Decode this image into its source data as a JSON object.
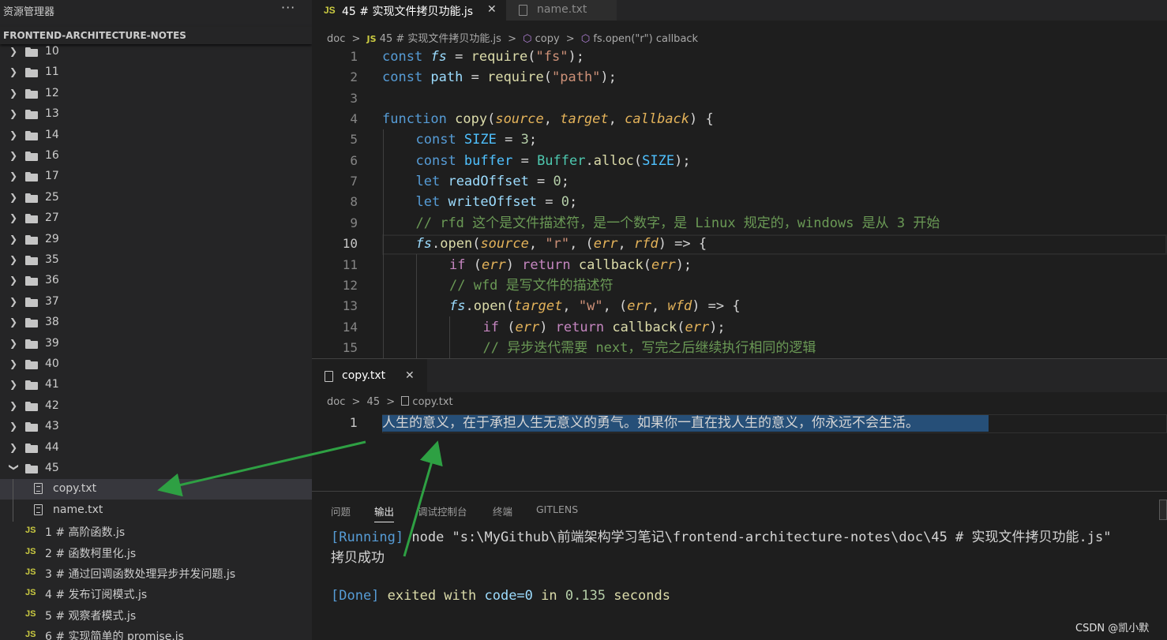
{
  "sidebar": {
    "title": "资源管理器",
    "more": "···",
    "root": "FRONTEND-ARCHITECTURE-NOTES",
    "folders": [
      "10",
      "11",
      "12",
      "13",
      "14",
      "16",
      "17",
      "25",
      "27",
      "29",
      "35",
      "36",
      "37",
      "38",
      "39",
      "40",
      "41",
      "42",
      "43",
      "44"
    ],
    "open_folder": "45",
    "open_folder_files": [
      "copy.txt",
      "name.txt"
    ],
    "js_badge": "JS",
    "js_files": [
      "1 # 高阶函数.js",
      "2 # 函数柯里化.js",
      "3 # 通过回调函数处理异步并发问题.js",
      "4 # 发布订阅模式.js",
      "5 # 观察者模式.js",
      "6 # 实现简单的 promise.js"
    ]
  },
  "editor_top": {
    "tabs": [
      {
        "badge": "JS",
        "label": "45 # 实现文件拷贝功能.js",
        "close": "✕",
        "active": true
      },
      {
        "label": "name.txt",
        "active": false
      }
    ],
    "breadcrumb": {
      "a": "doc",
      "b": "45 # 实现文件拷贝功能.js",
      "c": "copy",
      "d": "fs.open(\"r\") callback",
      "sep": ">"
    },
    "line_numbers": [
      "1",
      "2",
      "3",
      "4",
      "5",
      "6",
      "7",
      "8",
      "9",
      "10",
      "11",
      "12",
      "13",
      "14",
      "15"
    ],
    "code": {
      "l1": [
        "const ",
        "fs",
        " = ",
        "require",
        "(",
        "\"fs\"",
        ");"
      ],
      "l2": [
        "const ",
        "path",
        " = ",
        "require",
        "(",
        "\"path\"",
        ");"
      ],
      "l4": [
        "function ",
        "copy",
        "(",
        "source",
        ", ",
        "target",
        ", ",
        "callback",
        ") {"
      ],
      "l5": [
        "const ",
        "SIZE",
        " = ",
        "3",
        ";"
      ],
      "l6": [
        "const ",
        "buffer",
        " = ",
        "Buffer",
        ".",
        "alloc",
        "(",
        "SIZE",
        ");"
      ],
      "l7": [
        "let ",
        "readOffset",
        " = ",
        "0",
        ";"
      ],
      "l8": [
        "let ",
        "writeOffset",
        " = ",
        "0",
        ";"
      ],
      "l9": "// rfd 这个是文件描述符，是一个数字，是 Linux 规定的，windows 是从 3 开始",
      "l10": [
        "fs",
        ".",
        "open",
        "(",
        "source",
        ", ",
        "\"r\"",
        ", (",
        "err",
        ", ",
        "rfd",
        ") => {"
      ],
      "l11": [
        "if ",
        "(",
        "err",
        ") ",
        "return ",
        "callback",
        "(",
        "err",
        ");"
      ],
      "l12": "// wfd 是写文件的描述符",
      "l13": [
        "fs",
        ".",
        "open",
        "(",
        "target",
        ", ",
        "\"w\"",
        ", (",
        "err",
        ", ",
        "wfd",
        ") => {"
      ],
      "l14": [
        "if ",
        "(",
        "err",
        ") ",
        "return ",
        "callback",
        "(",
        "err",
        ");"
      ],
      "l15": "// 异步迭代需要 next，写完之后继续执行相同的逻辑"
    }
  },
  "editor_bottom": {
    "tab": {
      "label": "copy.txt",
      "close": "✕"
    },
    "breadcrumb": {
      "a": "doc",
      "b": "45",
      "c": "copy.txt",
      "sep": ">"
    },
    "line_number": "1",
    "content": "人生的意义，在于承担人生无意义的勇气。如果你一直在找人生的意义，你永远不会生活。"
  },
  "panel": {
    "tabs": [
      "问题",
      "输出",
      "调试控制台",
      "终端",
      "GITLENS"
    ],
    "active_tab": "输出",
    "running_tag": "[Running]",
    "running_cmd": " node \"s:\\MyGithub\\前端架构学习笔记\\frontend-architecture-notes\\doc\\45 # 实现文件拷贝功能.js\"",
    "result": "拷贝成功",
    "done_tag": "[Done]",
    "done_a": " exited with ",
    "done_code": "code=0",
    "done_b": " in ",
    "done_time": "0.135",
    "done_c": " seconds"
  },
  "watermark": "CSDN @凯小默",
  "colors": {
    "arrow": "#2ea043",
    "selection": "#264f78",
    "accent_blue": "#569cd6"
  }
}
